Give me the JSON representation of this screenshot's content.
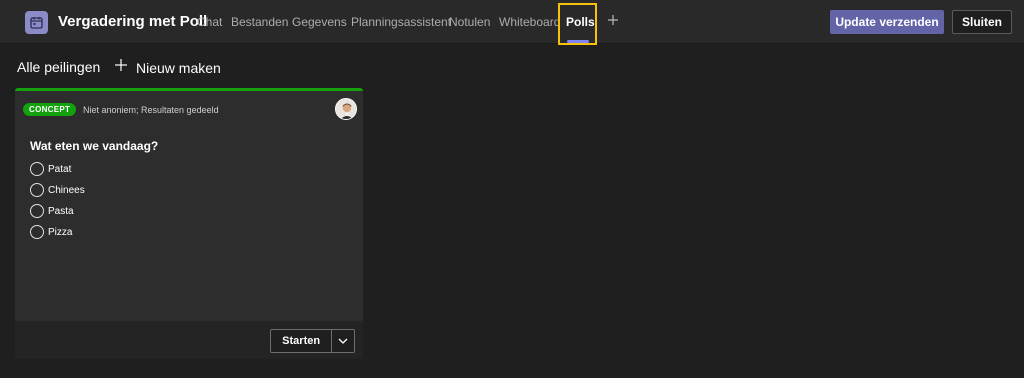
{
  "header": {
    "title": "Vergadering met Poll",
    "app_icon": "calendar-icon",
    "tabs": [
      {
        "label": "Chat"
      },
      {
        "label": "Bestanden"
      },
      {
        "label": "Gegevens"
      },
      {
        "label": "Planningsassistent"
      },
      {
        "label": "Notulen"
      },
      {
        "label": "Whiteboard"
      },
      {
        "label": "Polls",
        "active": true
      }
    ],
    "add_tab_icon": "plus-icon",
    "update_button": "Update verzenden",
    "close_button": "Sluiten"
  },
  "subbar": {
    "all_polls": "Alle peilingen",
    "new_label": "Nieuw maken"
  },
  "poll_card": {
    "status_badge": "CONCEPT",
    "meta": "Niet anoniem; Resultaten gedeeld",
    "question": "Wat eten we vandaag?",
    "options": [
      "Patat",
      "Chinees",
      "Pasta",
      "Pizza"
    ],
    "start_button": "Starten",
    "accent_color": "#13a10e"
  },
  "colors": {
    "brand": "#6264a7",
    "highlight": "#f4c20d"
  }
}
